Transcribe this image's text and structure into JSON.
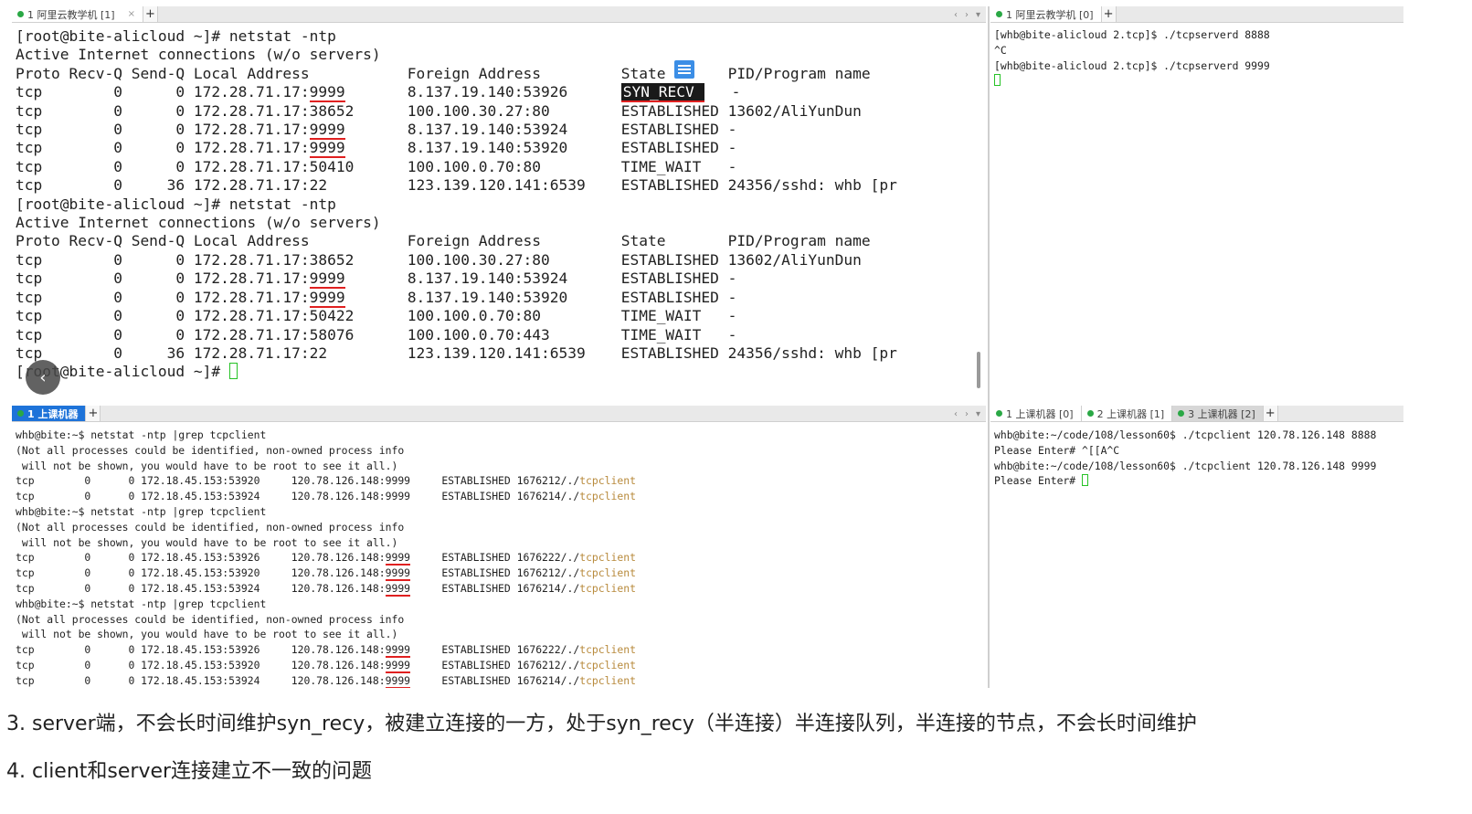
{
  "top_left": {
    "tabs": [
      {
        "label": "1 阿里云教学机 [1]",
        "close": "×"
      }
    ],
    "add": "+",
    "nav": [
      "‹",
      "›",
      "▾"
    ],
    "lines": [
      [
        {
          "t": "[root@bite-alicloud ~]# netstat -ntp"
        }
      ],
      [
        {
          "t": "Active Internet connections (w/o servers)"
        }
      ],
      [
        {
          "t": "Proto Recv-Q Send-Q Local Address           Foreign Address         State       PID/Program name"
        }
      ],
      [
        {
          "t": "tcp        0      0 172.28.71.17:"
        },
        {
          "t": "9999",
          "c": "ul"
        },
        {
          "t": "       8.137.19.140:53926      "
        },
        {
          "t": "SYN_RECV ",
          "c": "hl"
        },
        {
          "t": "   -"
        }
      ],
      [
        {
          "t": "tcp        0      0 172.28.71.17:38652      100.100.30.27:80        ESTABLISHED 13602/AliYunDun"
        }
      ],
      [
        {
          "t": "tcp        0      0 172.28.71.17:"
        },
        {
          "t": "9999",
          "c": "ul"
        },
        {
          "t": "       8.137.19.140:53924      ESTABLISHED -"
        }
      ],
      [
        {
          "t": "tcp        0      0 172.28.71.17:"
        },
        {
          "t": "9999",
          "c": "ul"
        },
        {
          "t": "       8.137.19.140:53920      ESTABLISHED -"
        }
      ],
      [
        {
          "t": "tcp        0      0 172.28.71.17:50410      100.100.0.70:80         TIME_WAIT   -"
        }
      ],
      [
        {
          "t": "tcp        0     36 172.28.71.17:22         123.139.120.141:6539    ESTABLISHED 24356/sshd: whb [pr"
        }
      ],
      [
        {
          "t": "[root@bite-alicloud ~]# netstat -ntp"
        }
      ],
      [
        {
          "t": "Active Internet connections (w/o servers)"
        }
      ],
      [
        {
          "t": "Proto Recv-Q Send-Q Local Address           Foreign Address         State       PID/Program name"
        }
      ],
      [
        {
          "t": "tcp        0      0 172.28.71.17:38652      100.100.30.27:80        ESTABLISHED 13602/AliYunDun"
        }
      ],
      [
        {
          "t": "tcp        0      0 172.28.71.17:"
        },
        {
          "t": "9999",
          "c": "ul"
        },
        {
          "t": "       8.137.19.140:53924      ESTABLISHED -"
        }
      ],
      [
        {
          "t": "tcp        0      0 172.28.71.17:"
        },
        {
          "t": "9999",
          "c": "ul"
        },
        {
          "t": "       8.137.19.140:53920      ESTABLISHED -"
        }
      ],
      [
        {
          "t": "tcp        0      0 172.28.71.17:50422      100.100.0.70:80         TIME_WAIT   -"
        }
      ],
      [
        {
          "t": "tcp        0      0 172.28.71.17:58076      100.100.0.70:443        TIME_WAIT   -"
        }
      ],
      [
        {
          "t": "tcp        0     36 172.28.71.17:22         123.139.120.141:6539    ESTABLISHED 24356/sshd: whb [pr"
        }
      ],
      [
        {
          "t": "[root@bite-alicloud ~]# "
        },
        {
          "c": "cursor"
        }
      ]
    ],
    "back_button": "‹"
  },
  "top_right": {
    "tabs": [
      {
        "label": "1 阿里云教学机 [0]"
      }
    ],
    "add": "+",
    "lines": [
      [
        {
          "t": "[whb@bite-alicloud 2.tcp]$ ./tcpserverd 8888"
        }
      ],
      [
        {
          "t": "^C"
        }
      ],
      [
        {
          "t": "[whb@bite-alicloud 2.tcp]$ ./tcpserverd 9999"
        }
      ],
      [
        {
          "c": "cursor-s"
        }
      ]
    ]
  },
  "bottom_left": {
    "tabs": [
      {
        "label": "1 上课机器"
      }
    ],
    "add": "+",
    "nav": [
      "‹",
      "›",
      "▾"
    ],
    "lines": [
      [
        {
          "t": "whb@bite:~$ netstat -ntp |grep tcpclient"
        }
      ],
      [
        {
          "t": "(Not all processes could be identified, non-owned process info"
        }
      ],
      [
        {
          "t": " will not be shown, you would have to be root to see it all.)"
        }
      ],
      [
        {
          "t": "tcp        0      0 172.18.45.153:53920     120.78.126.148:9999     ESTABLISHED 1676212/./"
        },
        {
          "t": "tcpclient",
          "c": "prog"
        }
      ],
      [
        {
          "t": "tcp        0      0 172.18.45.153:53924     120.78.126.148:9999     ESTABLISHED 1676214/./"
        },
        {
          "t": "tcpclient",
          "c": "prog"
        }
      ],
      [
        {
          "t": "whb@bite:~$ netstat -ntp |grep tcpclient"
        }
      ],
      [
        {
          "t": "(Not all processes could be identified, non-owned process info"
        }
      ],
      [
        {
          "t": " will not be shown, you would have to be root to see it all.)"
        }
      ],
      [
        {
          "t": "tcp        0      0 172.18.45.153:53926     120.78.126.148:"
        },
        {
          "t": "9999",
          "c": "ul"
        },
        {
          "t": "     ESTABLISHED 1676222/./"
        },
        {
          "t": "tcpclient",
          "c": "prog"
        }
      ],
      [
        {
          "t": "tcp        0      0 172.18.45.153:53920     120.78.126.148:"
        },
        {
          "t": "9999",
          "c": "ul"
        },
        {
          "t": "     ESTABLISHED 1676212/./"
        },
        {
          "t": "tcpclient",
          "c": "prog"
        }
      ],
      [
        {
          "t": "tcp        0      0 172.18.45.153:53924     120.78.126.148:"
        },
        {
          "t": "9999",
          "c": "ul"
        },
        {
          "t": "     ESTABLISHED 1676214/./"
        },
        {
          "t": "tcpclient",
          "c": "prog"
        }
      ],
      [
        {
          "t": "whb@bite:~$ netstat -ntp |grep tcpclient"
        }
      ],
      [
        {
          "t": "(Not all processes could be identified, non-owned process info"
        }
      ],
      [
        {
          "t": " will not be shown, you would have to be root to see it all.)"
        }
      ],
      [
        {
          "t": "tcp        0      0 172.18.45.153:53926     120.78.126.148:"
        },
        {
          "t": "9999",
          "c": "ul"
        },
        {
          "t": "     ESTABLISHED 1676222/./"
        },
        {
          "t": "tcpclient",
          "c": "prog"
        }
      ],
      [
        {
          "t": "tcp        0      0 172.18.45.153:53920     120.78.126.148:"
        },
        {
          "t": "9999",
          "c": "ul"
        },
        {
          "t": "     ESTABLISHED 1676212/./"
        },
        {
          "t": "tcpclient",
          "c": "prog"
        }
      ],
      [
        {
          "t": "tcp        0      0 172.18.45.153:53924     120.78.126.148:"
        },
        {
          "t": "9999",
          "c": "ul"
        },
        {
          "t": "     ESTABLISHED 1676214/./"
        },
        {
          "t": "tcpclient",
          "c": "prog"
        }
      ]
    ]
  },
  "bottom_right": {
    "tabs": [
      {
        "label": "1 上课机器 [0]"
      },
      {
        "label": "2 上课机器 [1]"
      },
      {
        "label": "3 上课机器 [2]"
      }
    ],
    "add": "+",
    "lines": [
      [
        {
          "t": "whb@bite:~/code/108/lesson60$ ./tcpclient 120.78.126.148 8888"
        }
      ],
      [
        {
          "t": "Please Enter# ^[[A^C"
        }
      ],
      [
        {
          "t": "whb@bite:~/code/108/lesson60$ ./tcpclient 120.78.126.148 9999"
        }
      ],
      [
        {
          "t": "Please Enter# "
        },
        {
          "c": "cursor-s"
        }
      ]
    ]
  },
  "captions": [
    "3. server端，不会长时间维护syn_recy，被建立连接的一方，处于syn_recy（半连接）半连接队列，半连接的节点，不会长时间维护",
    "4. client和server连接建立不一致的问题"
  ],
  "colors": {
    "accent_tab": "#1e73d9",
    "underline": "#e02020",
    "cursor": "#26c226",
    "program": "#b88a3c"
  }
}
